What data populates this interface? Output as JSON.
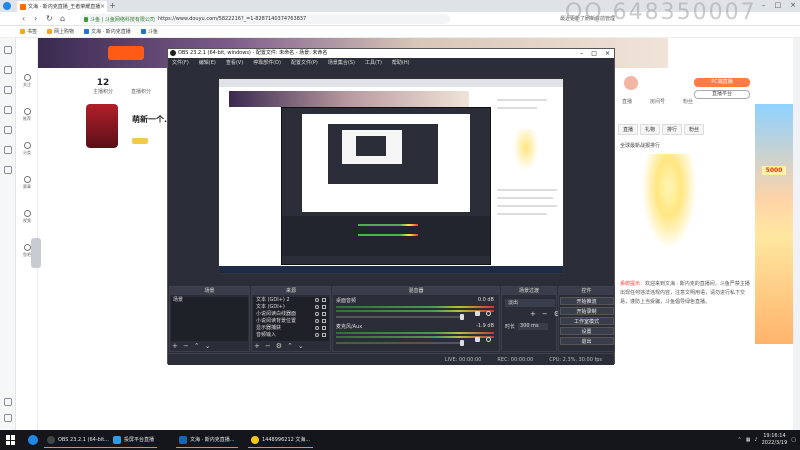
{
  "browser": {
    "tab_title": "文海 · 斯内克直播_王者荣耀直播",
    "url_site": "斗鱼 | 斗鱼网络科技有限公司",
    "url": "https://www.douyu.com/5822216?_=1-8287140374763837",
    "addr_right": "最近更新了刷新目前管理",
    "bookmarks": [
      "书签",
      "网上购物",
      "文海 · 斯内克直播",
      "斗鱼"
    ]
  },
  "site_sidebar": [
    "关注",
    "推荐",
    "分类",
    "赛事",
    "视频",
    "鱼吧"
  ],
  "site": {
    "stat1_value": "12",
    "stat1_label": "主播积分",
    "stat2_label": "直播积分",
    "anchor_name": "萌新一个...",
    "rp_btn": "PC端直播",
    "rp_btn2": "直播平台",
    "rp_stats": [
      "直播",
      "房间号",
      "粉丝"
    ],
    "rp_tabs": [
      "直播",
      "礼物",
      "排行",
      "粉丝"
    ],
    "rp_chat_title": "全球最新战报排行",
    "rp_text_red": "系统提示：",
    "rp_text": "欢迎来到文海 · 斯内克的直播间，斗鱼严禁主播出现任何违法违规内容，注意文明用语，请勿进行私下交易，谨防上当受骗，斗鱼倡导绿色直播。",
    "ad_value": "5000",
    "qq_watermark": "QQ 648350007"
  },
  "obs": {
    "title": "OBS 23.2.1 (64-bit, windows) - 配置文件: 未命名 - 场景: 未命名",
    "menu": [
      "文件(F)",
      "编辑(E)",
      "查看(V)",
      "停靠部件(D)",
      "配置文件(P)",
      "场景集合(S)",
      "工具(T)",
      "帮助(H)"
    ],
    "docks": {
      "scenes_title": "场景",
      "sources_title": "来源",
      "mixer_title": "混音器",
      "transitions_title": "场景过渡",
      "controls_title": "控件"
    },
    "scenes": [
      "场景"
    ],
    "sources": [
      "文本 (GDI+) 2",
      "文本 (GDI+)",
      "小说阅读白线器面",
      "小说阅读背景位置",
      "显示器捕获",
      "音频输入"
    ],
    "mixer": [
      {
        "name": "麦克风/Aux",
        "db": "-1.9 dB"
      },
      {
        "name": "桌面音频",
        "db": "0.0 dB"
      }
    ],
    "transition": {
      "type": "淡出",
      "duration_label": "时长",
      "duration": "300 ms"
    },
    "controls": [
      "开始推流",
      "开始录制",
      "工作室模式",
      "设置",
      "退出"
    ],
    "status": {
      "live": "LIVE: 00:00:00",
      "rec": "REC: 00:00:00",
      "cpu": "CPU: 2.3%, 30.00 fps"
    }
  },
  "taskbar": {
    "apps": [
      "OBS 23.2.1 (64-bit...",
      "投屏平台直播",
      "文海 · 斯内克直播...",
      "1448996212 文海..."
    ],
    "time": "19:16:14",
    "date": "2022/3/19"
  }
}
